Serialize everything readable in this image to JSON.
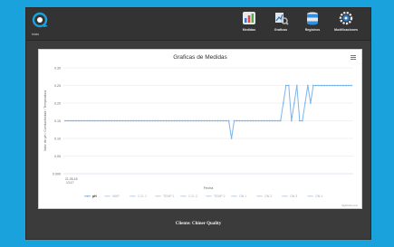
{
  "brand": {
    "label": "Inicio"
  },
  "nav": [
    {
      "label": "Medidas",
      "icon": "measurements-icon"
    },
    {
      "label": "Graficas",
      "icon": "charts-icon"
    },
    {
      "label": "Registros",
      "icon": "database-icon"
    },
    {
      "label": "Modificaciones",
      "icon": "settings-icon"
    }
  ],
  "colors": {
    "accent": "#1aa2dc",
    "series": "#7cb5ec",
    "grid": "#e6e6e6"
  },
  "chart_data": {
    "type": "line",
    "title": "Graficas de Medidas",
    "xlabel": "Fecha",
    "ylabel": "Valor de pH / Conductividad / Temperatura",
    "y_tick_labels": [
      "0.000",
      "0.05",
      "0.10",
      "0.15",
      "0.20",
      "0.25",
      "0.30"
    ],
    "x_tick_labels": [
      "21-05-18 / 13:17"
    ],
    "ylim": [
      0,
      0.3
    ],
    "series": [
      {
        "name": "pH",
        "values": [
          0.15,
          0.15,
          0.15,
          0.15,
          0.15,
          0.15,
          0.15,
          0.15,
          0.15,
          0.15,
          0.15,
          0.15,
          0.15,
          0.15,
          0.15,
          0.15,
          0.15,
          0.15,
          0.15,
          0.15,
          0.15,
          0.15,
          0.15,
          0.15,
          0.15,
          0.15,
          0.15,
          0.15,
          0.15,
          0.15,
          0.15,
          0.15,
          0.15,
          0.15,
          0.15,
          0.15,
          0.15,
          0.15,
          0.15,
          0.15,
          0.15,
          0.15,
          0.15,
          0.15,
          0.15,
          0.15,
          0.15,
          0.15,
          0.15,
          0.15,
          0.15,
          0.15,
          0.15,
          0.15,
          0.15,
          0.15,
          0.15,
          0.15,
          0.15,
          0.15,
          0.15,
          0.1,
          0.15,
          0.15,
          0.15,
          0.15,
          0.15,
          0.15,
          0.15,
          0.15,
          0.15,
          0.15,
          0.15,
          0.15,
          0.15,
          0.15,
          0.15,
          0.15,
          0.15,
          0.15,
          0.2,
          0.25,
          0.25,
          0.15,
          0.2,
          0.25,
          0.15,
          0.15,
          0.2,
          0.25,
          0.2,
          0.25,
          0.25,
          0.25,
          0.25,
          0.25,
          0.25,
          0.25,
          0.25,
          0.25,
          0.25,
          0.25,
          0.25,
          0.25,
          0.25,
          0.25
        ]
      },
      {
        "name": "NMP",
        "values": []
      },
      {
        "name": "C.D. 1",
        "values": []
      },
      {
        "name": "TEMP 1",
        "values": []
      },
      {
        "name": "C.D. 2",
        "values": []
      },
      {
        "name": "TEMP 2",
        "values": []
      },
      {
        "name": "ON 1",
        "values": []
      },
      {
        "name": "ON 2",
        "values": []
      },
      {
        "name": "ON 3",
        "values": []
      },
      {
        "name": "ON 4",
        "values": []
      }
    ],
    "legend_position": "bottom",
    "credits": "Highcharts.com"
  },
  "footer": {
    "text": "Cliente: Chiner Quality"
  }
}
